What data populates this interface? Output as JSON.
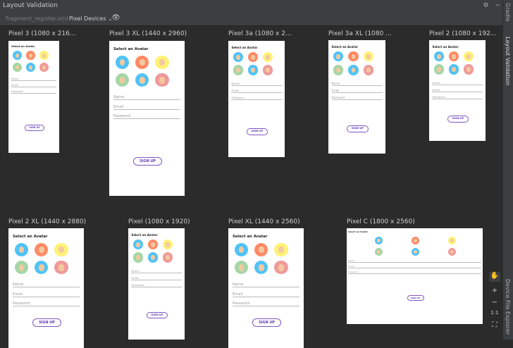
{
  "window": {
    "title": "Layout Validation"
  },
  "toolbar": {
    "file": "fragment_register.xml",
    "devices": "Pixel Devices",
    "devices_chevron": "⌄"
  },
  "side_tabs": [
    "Gradle",
    "Layout Validation",
    "Device File Explorer"
  ],
  "screen": {
    "select_avatar": "Select an Avatar",
    "name": "Name",
    "email": "Email",
    "password": "Password",
    "signup": "SIGN UP"
  },
  "devices": [
    {
      "label": "Pixel 3 (1080 x 216..."
    },
    {
      "label": "Pixel 3 XL (1440 x 2960)"
    },
    {
      "label": "Pixel 3a (1080 x 2..."
    },
    {
      "label": "Pixel 3a XL (1080 ..."
    },
    {
      "label": "Pixel 2 (1080 x 192..."
    },
    {
      "label": "Pixel 2 XL (1440 x 2880)"
    },
    {
      "label": "Pixel (1080 x 1920)"
    },
    {
      "label": "Pixel XL (1440 x 2560)"
    },
    {
      "label": "Pixel C (1800 x 2560)"
    }
  ],
  "zoom_controls": {
    "fit": "1:1"
  },
  "avatar_colors": [
    "#4fc3f7",
    "#ff8a65",
    "#fff176",
    "#a5d6a7",
    "#4fc3f7",
    "#ef9a9a"
  ]
}
